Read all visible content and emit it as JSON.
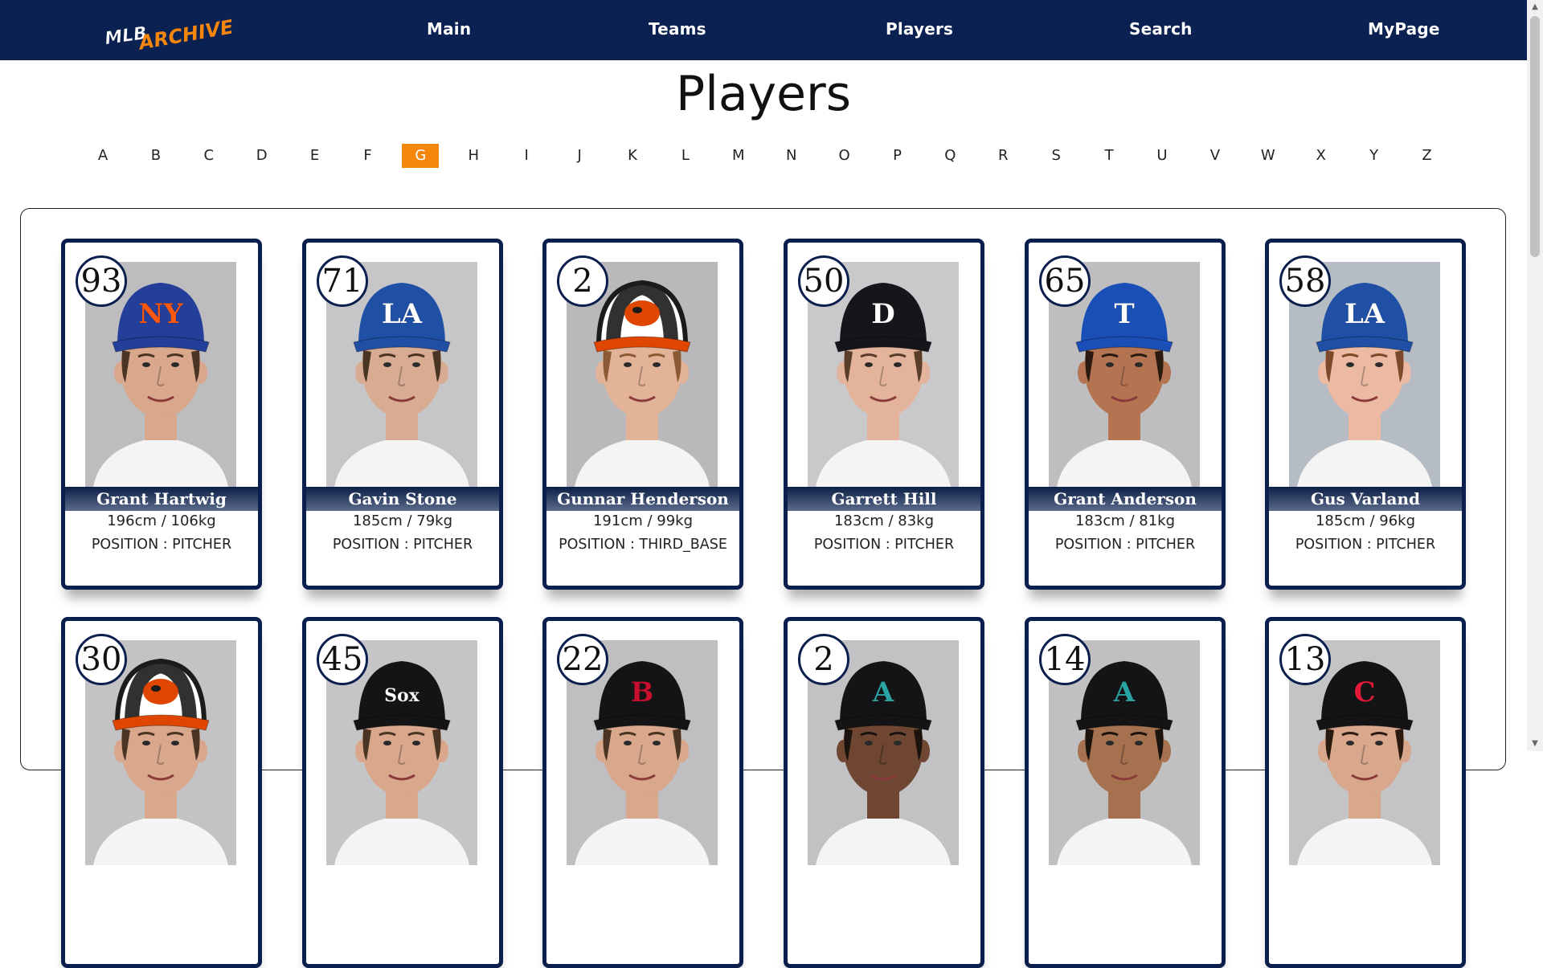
{
  "nav": {
    "logo_text_1": "MLB",
    "logo_text_2": "ARCHIVE !",
    "links": [
      {
        "label": "Main"
      },
      {
        "label": "Teams"
      },
      {
        "label": "Players"
      },
      {
        "label": "Search"
      },
      {
        "label": "MyPage"
      }
    ]
  },
  "page_title": "Players",
  "letters": [
    "A",
    "B",
    "C",
    "D",
    "E",
    "F",
    "G",
    "H",
    "I",
    "J",
    "K",
    "L",
    "M",
    "N",
    "O",
    "P",
    "Q",
    "R",
    "S",
    "T",
    "U",
    "V",
    "W",
    "X",
    "Y",
    "Z"
  ],
  "active_letter": "G",
  "players": [
    {
      "number": "93",
      "name": "Grant Hartwig",
      "measure": "196cm / 106kg",
      "position": "POSITION : PITCHER",
      "team": "NY Mets",
      "cap_color": "#233f9a",
      "logo_color": "#ff5910",
      "logo_text": "NY",
      "bg": "#bdbdc0",
      "skin": "#d9a78b",
      "hair": "#4a3424"
    },
    {
      "number": "71",
      "name": "Gavin Stone",
      "measure": "185cm / 79kg",
      "position": "POSITION : PITCHER",
      "team": "Los Angeles Dodgers",
      "cap_color": "#2050a6",
      "logo_color": "#ffffff",
      "logo_text": "LA",
      "bg": "#c6c6c8",
      "skin": "#d8ac92",
      "hair": "#4a3424"
    },
    {
      "number": "2",
      "name": "Gunnar Henderson",
      "measure": "191cm / 99kg",
      "position": "POSITION : THIRD_BASE",
      "team": "Baltimore Orioles",
      "cap_color": "#ffffff",
      "logo_color": "#df4601",
      "logo_text": "",
      "bg": "#b9b9bb",
      "skin": "#e2b397",
      "hair": "#8a5b35"
    },
    {
      "number": "50",
      "name": "Garrett Hill",
      "measure": "183cm / 83kg",
      "position": "POSITION : PITCHER",
      "team": "Detroit Tigers",
      "cap_color": "#15161a",
      "logo_color": "#ffffff",
      "logo_text": "D",
      "bg": "#c9c9cb",
      "skin": "#e3b49b",
      "hair": "#5a3d28"
    },
    {
      "number": "65",
      "name": "Grant Anderson",
      "measure": "183cm / 81kg",
      "position": "POSITION : PITCHER",
      "team": "Texas Rangers",
      "cap_color": "#1a4fb8",
      "logo_color": "#ffffff",
      "logo_text": "T",
      "bg": "#bebec0",
      "skin": "#b47452",
      "hair": "#2a1a10"
    },
    {
      "number": "58",
      "name": "Gus Varland",
      "measure": "185cm / 96kg",
      "position": "POSITION : PITCHER",
      "team": "Los Angeles Dodgers",
      "cap_color": "#2050a6",
      "logo_color": "#ffffff",
      "logo_text": "LA",
      "bg": "#b6bcc4",
      "skin": "#ecbaa3",
      "hair": "#7a4a2b"
    },
    {
      "number": "30",
      "name": "",
      "measure": "",
      "position": "",
      "team": "Baltimore Orioles",
      "cap_color": "#ffffff",
      "logo_color": "#df4601",
      "logo_text": "",
      "bg": "#c3c3c5",
      "skin": "#d9a78b",
      "hair": "#4a3424"
    },
    {
      "number": "45",
      "name": "",
      "measure": "",
      "position": "",
      "team": "Chicago White Sox",
      "cap_color": "#141416",
      "logo_color": "#ffffff",
      "logo_text": "Sox",
      "bg": "#c5c5c7",
      "skin": "#d9a78b",
      "hair": "#4a3424"
    },
    {
      "number": "22",
      "name": "",
      "measure": "",
      "position": "",
      "team": "Boston Red Sox",
      "cap_color": "#141416",
      "logo_color": "#c8102e",
      "logo_text": "B",
      "bg": "#bfbfc1",
      "skin": "#d9a78b",
      "hair": "#4a3424"
    },
    {
      "number": "2",
      "name": "",
      "measure": "",
      "position": "",
      "team": "Arizona Diamondbacks",
      "cap_color": "#141416",
      "logo_color": "#2aa3a3",
      "logo_text": "A",
      "bg": "#c2c2c4",
      "skin": "#6e4632",
      "hair": "#1b130d"
    },
    {
      "number": "14",
      "name": "",
      "measure": "",
      "position": "",
      "team": "Arizona Diamondbacks",
      "cap_color": "#141416",
      "logo_color": "#2aa3a3",
      "logo_text": "A",
      "bg": "#c0c0c2",
      "skin": "#a5714f",
      "hair": "#1b130d"
    },
    {
      "number": "13",
      "name": "",
      "measure": "",
      "position": "",
      "team": "Cleveland Guardians",
      "cap_color": "#141416",
      "logo_color": "#e31937",
      "logo_text": "C",
      "bg": "#c4c4c6",
      "skin": "#d9a78b",
      "hair": "#2a1a10"
    }
  ]
}
